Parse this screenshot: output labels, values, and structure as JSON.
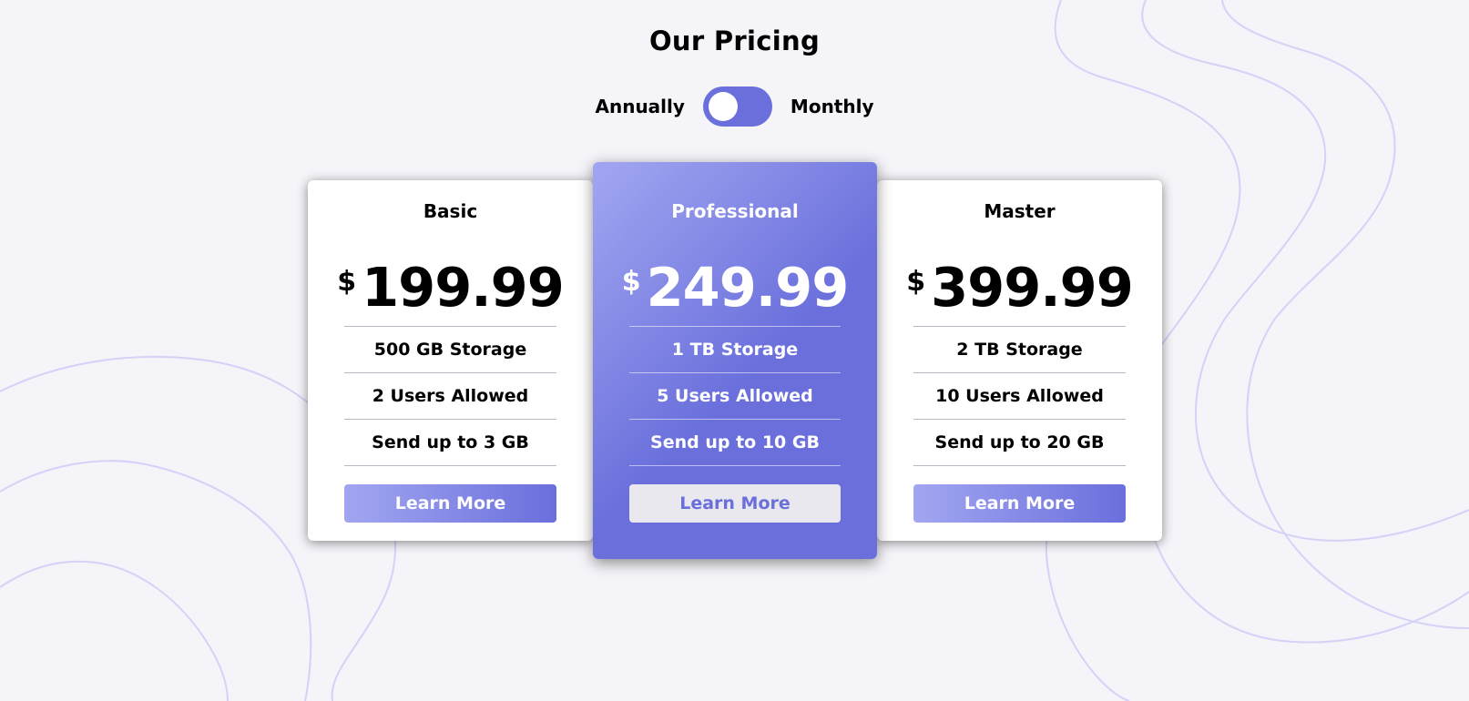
{
  "title": "Our Pricing",
  "toggle": {
    "left_label": "Annually",
    "right_label": "Monthly",
    "color": "#6a6fdc"
  },
  "plans": [
    {
      "name": "Basic",
      "currency": "$",
      "price": "199.99",
      "features": [
        "500 GB Storage",
        "2 Users Allowed",
        "Send up to 3 GB"
      ],
      "button_label": "Learn More"
    },
    {
      "name": "Professional",
      "currency": "$",
      "price": "249.99",
      "features": [
        "1 TB Storage",
        "5 Users Allowed",
        "Send up to 10 GB"
      ],
      "button_label": "Learn More"
    },
    {
      "name": "Master",
      "currency": "$",
      "price": "399.99",
      "features": [
        "2 TB Storage",
        "10 Users Allowed",
        "Send up to 20 GB"
      ],
      "button_label": "Learn More"
    }
  ],
  "colors": {
    "accent": "#6a6fdc",
    "accent_light": "#a2a6f1",
    "background": "#f4f4f9",
    "decorative_lines": "#d4d2f7"
  }
}
